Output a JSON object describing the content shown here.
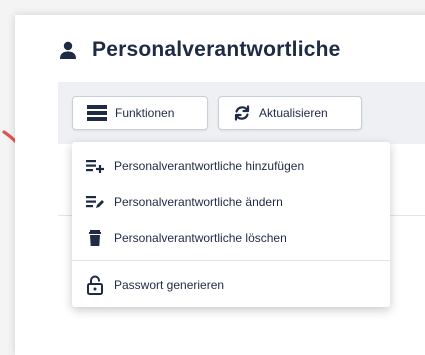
{
  "header": {
    "title": "Personalverantwortliche",
    "icon": "user-icon"
  },
  "toolbar": {
    "functions_label": "Funktionen",
    "functions_icon": "menu-list-icon",
    "refresh_label": "Aktualisieren",
    "refresh_icon": "refresh-icon"
  },
  "menu": {
    "items": [
      {
        "label": "Personalverantwortliche hinzufügen",
        "icon": "list-add-icon"
      },
      {
        "label": "Personalverantwortliche ändern",
        "icon": "list-edit-icon"
      },
      {
        "label": "Personalverantwortliche löschen",
        "icon": "trash-icon"
      },
      {
        "label": "Passwort generieren",
        "icon": "lock-open-icon"
      }
    ]
  },
  "colors": {
    "text": "#1f2a44",
    "arrow": "#e0564f"
  }
}
